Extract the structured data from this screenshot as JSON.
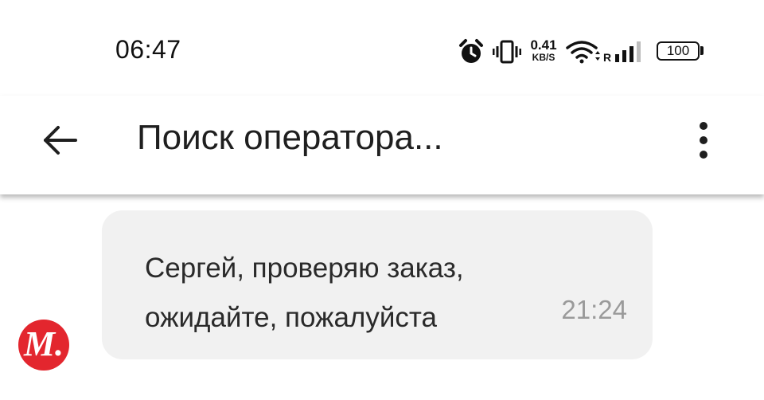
{
  "status_bar": {
    "time": "06:47",
    "net_speed_value": "0.41",
    "net_speed_unit": "KB/S",
    "roaming": "R",
    "battery": "100",
    "icons": [
      "alarm-icon",
      "vibrate-icon",
      "wifi-icon",
      "signal-icon",
      "battery-icon"
    ]
  },
  "app_bar": {
    "title": "Поиск оператора...",
    "back_icon": "arrow-left-icon",
    "menu_icon": "more-vertical-icon"
  },
  "chat": {
    "avatar_letter": "M.",
    "avatar_color": "#e3262e",
    "messages": [
      {
        "text": "Сергей, проверяю заказ, ожидайте, пожалуйста",
        "time": "21:24"
      }
    ]
  }
}
